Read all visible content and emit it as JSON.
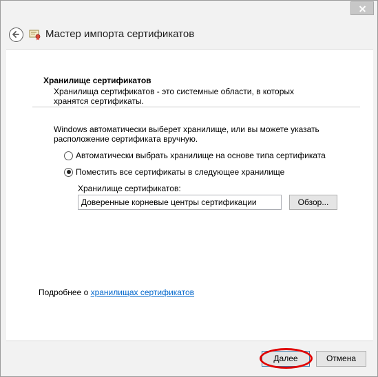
{
  "window": {
    "title": "Мастер импорта сертификатов"
  },
  "section": {
    "title": "Хранилище сертификатов",
    "description": "Хранилища сертификатов - это системные области, в которых\nхранятся сертификаты."
  },
  "info": "Windows автоматически выберет хранилище, или вы можете указать\nрасположение сертификата вручную.",
  "options": [
    {
      "label": "Автоматически выбрать хранилище на основе типа сертификата",
      "checked": false
    },
    {
      "label": "Поместить все сертификаты в следующее хранилище",
      "checked": true
    }
  ],
  "store": {
    "label": "Хранилище сертификатов:",
    "value": "Доверенные корневые центры сертификации",
    "browse_label": "Обзор..."
  },
  "more_info": {
    "prefix": "Подробнее о ",
    "link": "хранилищах сертификатов"
  },
  "buttons": {
    "next": "Далее",
    "cancel": "Отмена"
  },
  "colors": {
    "link": "#0066cc",
    "highlight": "#e00000"
  }
}
